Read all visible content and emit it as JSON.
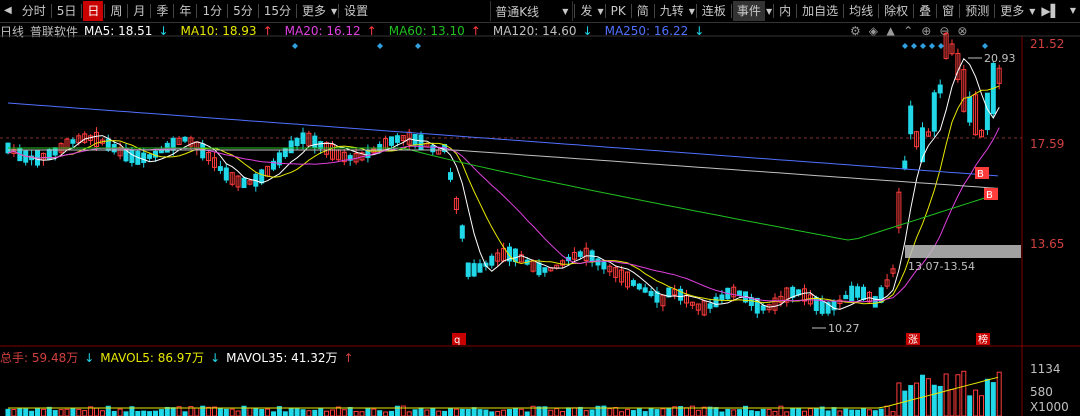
{
  "toolbar": {
    "back_icon": "back-arrow",
    "items": [
      {
        "label": "分时",
        "active": false
      },
      {
        "label": "5日",
        "active": false
      },
      {
        "label": "日",
        "active": true
      },
      {
        "label": "周",
        "active": false
      },
      {
        "label": "月",
        "active": false
      },
      {
        "label": "季",
        "active": false
      },
      {
        "label": "年",
        "active": false
      },
      {
        "label": "1分",
        "active": false
      },
      {
        "label": "5分",
        "active": false
      },
      {
        "label": "15分",
        "active": false
      },
      {
        "label": "更多",
        "active": false
      },
      {
        "label": "设置",
        "active": false
      }
    ],
    "chart_type": "普通K线",
    "right_items": [
      "发",
      "PK",
      "简",
      "九转",
      "连板",
      "事件",
      "内",
      "加自选",
      "均线",
      "除权",
      "叠",
      "窗",
      "预测",
      "更多"
    ]
  },
  "legend": {
    "period": "日线",
    "stock_name": "普联软件",
    "ma": [
      {
        "label": "MA5: 18.51",
        "dir": "↓",
        "color": "#ffffff"
      },
      {
        "label": "MA10: 18.93",
        "dir": "↑",
        "color": "#e8e800"
      },
      {
        "label": "MA20: 16.12",
        "dir": "↑",
        "color": "#e040e0"
      },
      {
        "label": "MA60: 13.10",
        "dir": "↑",
        "color": "#20c020"
      },
      {
        "label": "MA120: 14.60",
        "dir": "↓",
        "color": "#c0c0c0"
      },
      {
        "label": "MA250: 16.22",
        "dir": "↓",
        "color": "#5070ff"
      }
    ]
  },
  "volume_legend": {
    "total": "总手: 59.48万",
    "total_dir": "↓",
    "mavol5": "MAVOL5: 86.97万",
    "mavol5_dir": "↓",
    "mavol35": "MAVOL35: 41.32万",
    "mavol35_dir": "↑"
  },
  "price_axis": [
    "21.52",
    "17.59",
    "13.65"
  ],
  "volume_axis": [
    "1134",
    "580",
    "X1000"
  ],
  "annotations": {
    "high": "20.93",
    "low": "10.27",
    "range": "13.07-13.54",
    "marker_q": "q",
    "marker_zhang": "涨",
    "marker_bang": "榜",
    "marker_b1": "B",
    "marker_b2": "B"
  },
  "colors": {
    "up": "#ff3c3c",
    "down": "#20d8e8",
    "ma5": "#ffffff",
    "ma10": "#e8e800",
    "ma20": "#e040e0",
    "ma60": "#20c020",
    "ma120": "#c0c0c0",
    "ma250": "#5070ff",
    "active_tab": "#c80000"
  }
}
